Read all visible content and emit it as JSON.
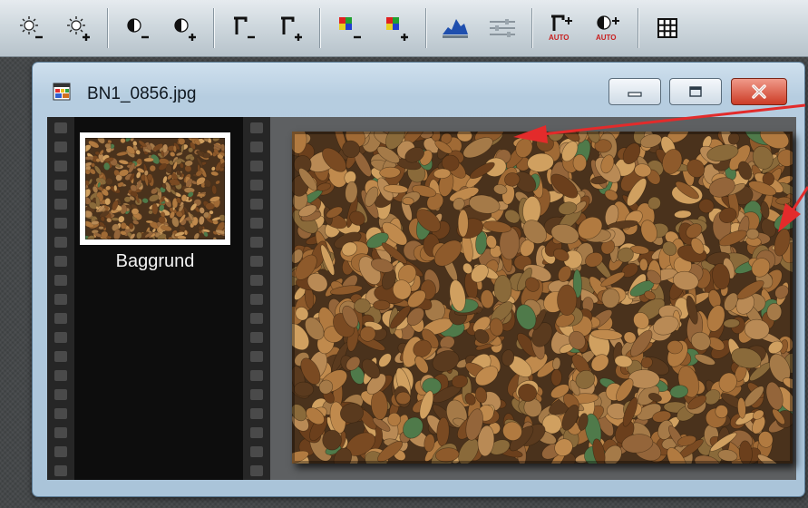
{
  "toolbar": {
    "buttons": [
      {
        "icon": "brightness-decrease-icon",
        "sign": "−"
      },
      {
        "icon": "brightness-increase-icon",
        "sign": "+"
      },
      {
        "icon": "contrast-decrease-icon",
        "sign": "−"
      },
      {
        "icon": "contrast-increase-icon",
        "sign": "+"
      },
      {
        "icon": "gamma-decrease-icon",
        "sign": "−"
      },
      {
        "icon": "gamma-increase-icon",
        "sign": "+"
      },
      {
        "icon": "saturation-decrease-icon",
        "sign": "−"
      },
      {
        "icon": "saturation-increase-icon",
        "sign": "+"
      },
      {
        "icon": "histogram-icon"
      },
      {
        "icon": "levels-sliders-icon"
      },
      {
        "icon": "auto-gamma-icon",
        "sign": "+",
        "badge": "AUTO"
      },
      {
        "icon": "auto-contrast-icon",
        "sign": "+",
        "badge": "AUTO"
      },
      {
        "icon": "grid-icon"
      }
    ]
  },
  "window": {
    "title": "BN1_0856.jpg",
    "controls": [
      "minimize-button",
      "maximize-button",
      "close-button"
    ]
  },
  "filmstrip": {
    "layers": [
      {
        "label": "Baggrund",
        "selected": true
      }
    ]
  },
  "colors": {
    "toolbar_top": "#e6ebef",
    "window_frame": "#aac4d9",
    "close_red": "#cc3c26",
    "annotation_arrow": "#e32b2b",
    "film_black": "#0d0d0d"
  }
}
